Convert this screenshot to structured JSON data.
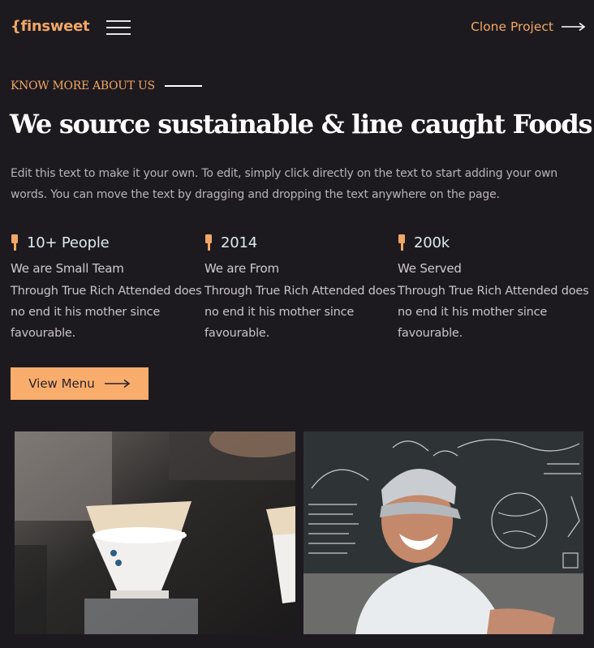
{
  "nav": {
    "logo": "{finsweet",
    "menu_icon": "hamburger-icon",
    "clone_label": "Clone Project",
    "clone_icon": "arrow-right-icon"
  },
  "hero": {
    "kicker": "KNOW MORE ABOUT US",
    "headline": "We source sustainable & line caught Foods",
    "intro": "Edit this text to make it your own. To edit, simply click directly on the text to start adding your own words. You can move the text by dragging and dropping the text anywhere on the page."
  },
  "stats": [
    {
      "value": "10+ People",
      "label": "We are Small Team",
      "desc": "Through True Rich Attended does no end it his mother since favourable."
    },
    {
      "value": "2014",
      "label": "We are From",
      "desc": "Through True Rich Attended does no end it his mother since favourable."
    },
    {
      "value": "200k",
      "label": "We Served",
      "desc": "Through True Rich Attended does no end it his mother since favourable."
    }
  ],
  "cta": {
    "label": "View Menu",
    "icon": "arrow-right-icon"
  },
  "photos": [
    {
      "icon": "coffee-pour-over-photo"
    },
    {
      "icon": "smiling-man-photo"
    }
  ],
  "colors": {
    "background": "#1d1a1f",
    "accent": "#f2a766",
    "button": "#f9ad6d"
  }
}
